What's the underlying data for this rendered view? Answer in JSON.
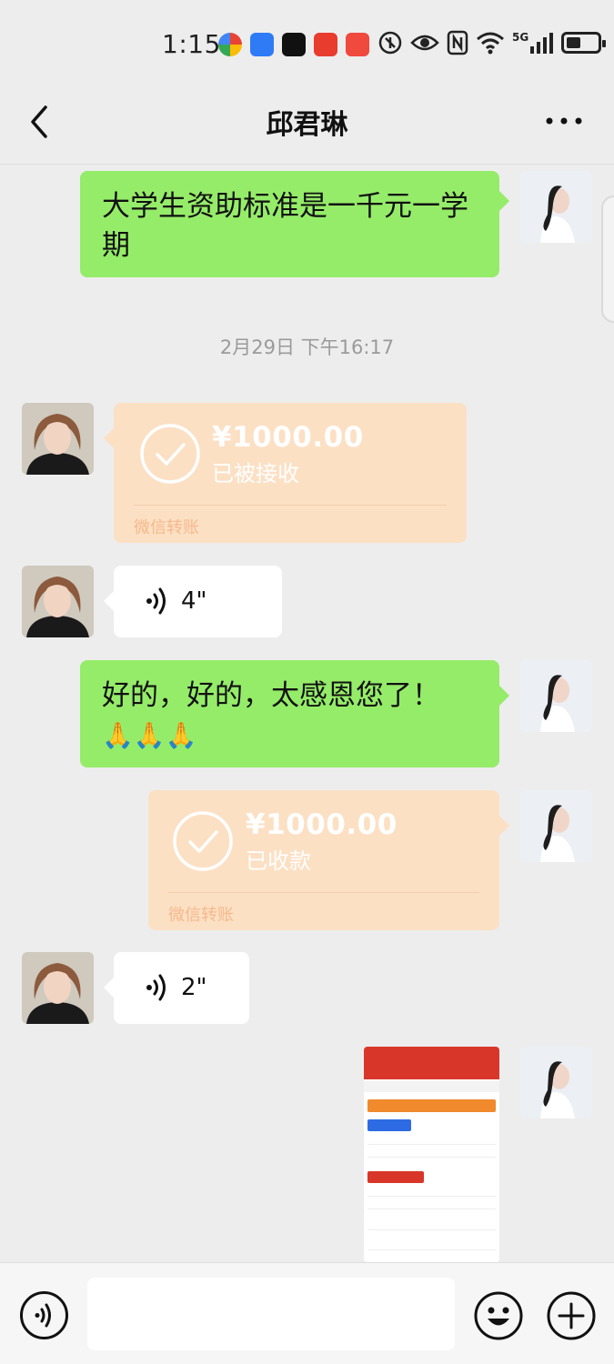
{
  "status_bar": {
    "time": "1:15",
    "network": "5G"
  },
  "header": {
    "title": "邱君琳"
  },
  "messages": {
    "m1": {
      "text": "大学生资助标准是一千元一学期"
    },
    "timestamp": "2月29日 下午16:17",
    "transfer1": {
      "amount": "¥1000.00",
      "status": "已被接收",
      "footer": "微信转账"
    },
    "voice1": {
      "duration": "4\""
    },
    "m2": {
      "text": "好的，好的，太感恩您了！",
      "emoji": "🙏🙏🙏"
    },
    "transfer2": {
      "amount": "¥1000.00",
      "status": "已收款",
      "footer": "微信转账"
    },
    "voice2": {
      "duration": "2\""
    }
  },
  "input": {
    "placeholder": "",
    "value": ""
  },
  "colors": {
    "background": "#ededed",
    "sent_bubble": "#95ec69",
    "received_bubble": "#ffffff",
    "transfer_bubble": "#fce0c4"
  }
}
